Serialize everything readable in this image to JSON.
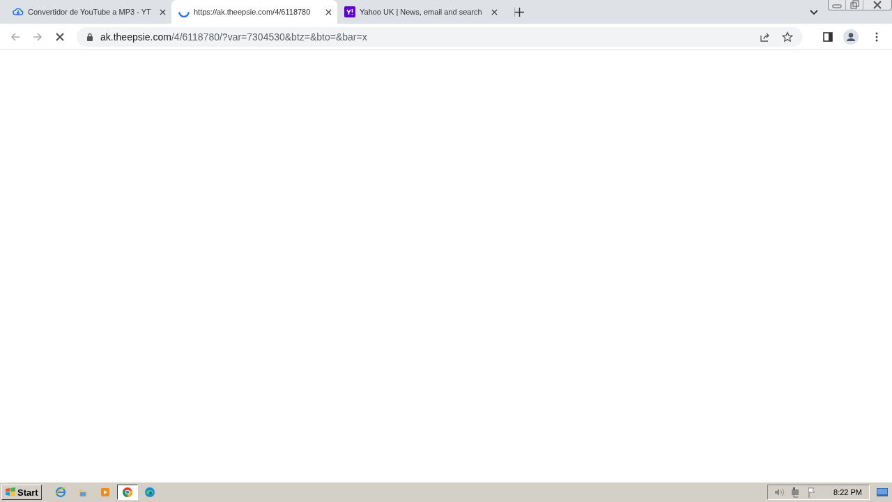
{
  "tabs": [
    {
      "title": "Convertidor de YouTube a MP3 - YT",
      "kind": "download",
      "selected": false
    },
    {
      "title": "https://ak.theepsie.com/4/6118780",
      "kind": "spinner",
      "selected": true
    },
    {
      "title": "Yahoo UK | News, email and search",
      "kind": "yahoo",
      "selected": false
    }
  ],
  "address_bar": {
    "host": "ak.theepsie.com",
    "path": "/4/6118780/?var=7304530&btz=&bto=&bar=x"
  },
  "taskbar": {
    "start": "Start",
    "apps": [
      {
        "kind": "ie",
        "selected": false
      },
      {
        "kind": "folder",
        "selected": false
      },
      {
        "kind": "media",
        "selected": false
      },
      {
        "kind": "chrome",
        "selected": true
      },
      {
        "kind": "edge",
        "selected": false
      }
    ],
    "clock": "8:22 PM"
  }
}
